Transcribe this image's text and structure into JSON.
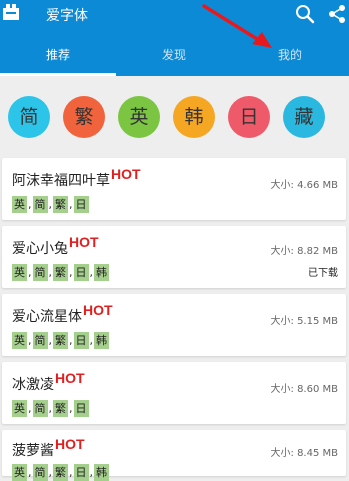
{
  "app": {
    "title": "爱字体"
  },
  "tabs": [
    {
      "label": "推荐",
      "active": true
    },
    {
      "label": "发现",
      "active": false
    },
    {
      "label": "我的",
      "active": false
    }
  ],
  "filters": [
    {
      "label": "简",
      "color": "#2cc4e8"
    },
    {
      "label": "繁",
      "color": "#f0633c"
    },
    {
      "label": "英",
      "color": "#7cc542"
    },
    {
      "label": "韩",
      "color": "#f5a623"
    },
    {
      "label": "日",
      "color": "#ef5a6a"
    },
    {
      "label": "藏",
      "color": "#2ab8e0"
    }
  ],
  "fonts": [
    {
      "name": "阿沫幸福四叶草",
      "hot": "HOT",
      "size": "大小: 4.66 MB",
      "status": "",
      "langs": [
        "英",
        "简",
        "繁",
        "日"
      ]
    },
    {
      "name": "爱心小兔",
      "hot": "HOT",
      "size": "大小: 8.82 MB",
      "status": "已下载",
      "langs": [
        "英",
        "简",
        "繁",
        "日",
        "韩"
      ]
    },
    {
      "name": "爱心流星体",
      "hot": "HOT",
      "size": "大小: 5.15 MB",
      "status": "",
      "langs": [
        "英",
        "简",
        "繁",
        "日",
        "韩"
      ]
    },
    {
      "name": "冰激凌",
      "hot": "HOT",
      "size": "大小: 8.60 MB",
      "status": "",
      "langs": [
        "英",
        "简",
        "繁",
        "日"
      ]
    },
    {
      "name": "菠萝酱",
      "hot": "HOT",
      "size": "大小: 8.45 MB",
      "status": "",
      "langs": [
        "英",
        "简",
        "繁",
        "日",
        "韩"
      ]
    }
  ],
  "colors": {
    "appbar": "#0d8ad6",
    "tag": "#a5cf8c",
    "hot": "#e02020"
  }
}
